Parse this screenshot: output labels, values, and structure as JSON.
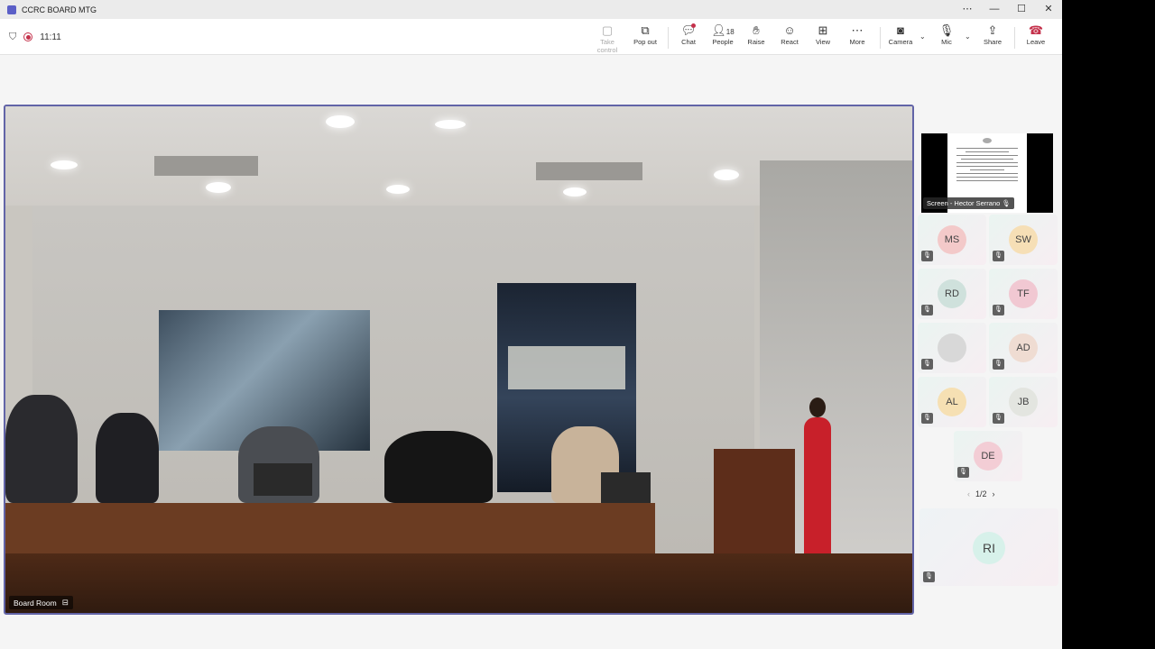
{
  "window": {
    "title": "CCRC BOARD MTG",
    "controls": [
      "⋯",
      "—",
      "☐",
      "✕"
    ]
  },
  "meeting": {
    "timer": "11:11"
  },
  "toolbar": {
    "take_control": "Take control",
    "pop_out": "Pop out",
    "chat": "Chat",
    "people": "People",
    "people_count": "18",
    "raise": "Raise",
    "react": "React",
    "view": "View",
    "more": "More",
    "camera": "Camera",
    "mic": "Mic",
    "share": "Share",
    "leave": "Leave"
  },
  "stage": {
    "label": "Board Room"
  },
  "screen_share": {
    "label": "Screen - Hector Serrano"
  },
  "participants": [
    {
      "initials": "MS",
      "color": "#f3c9c9"
    },
    {
      "initials": "SW",
      "color": "#f6dfb6"
    },
    {
      "initials": "RD",
      "color": "#cfe1dc"
    },
    {
      "initials": "TF",
      "color": "#f1c8d2"
    },
    {
      "initials": "",
      "color": "#d8d8d8"
    },
    {
      "initials": "AD",
      "color": "#efdcd2"
    },
    {
      "initials": "AL",
      "color": "#f6e0b3"
    },
    {
      "initials": "JB",
      "color": "#e3e5e0"
    },
    {
      "initials": "DE",
      "color": "#f3cdd5"
    }
  ],
  "pager": {
    "text": "1/2",
    "prev": "‹",
    "next": "›"
  },
  "bottom_participant": {
    "initials": "RI",
    "color": "#d7f1ea"
  }
}
